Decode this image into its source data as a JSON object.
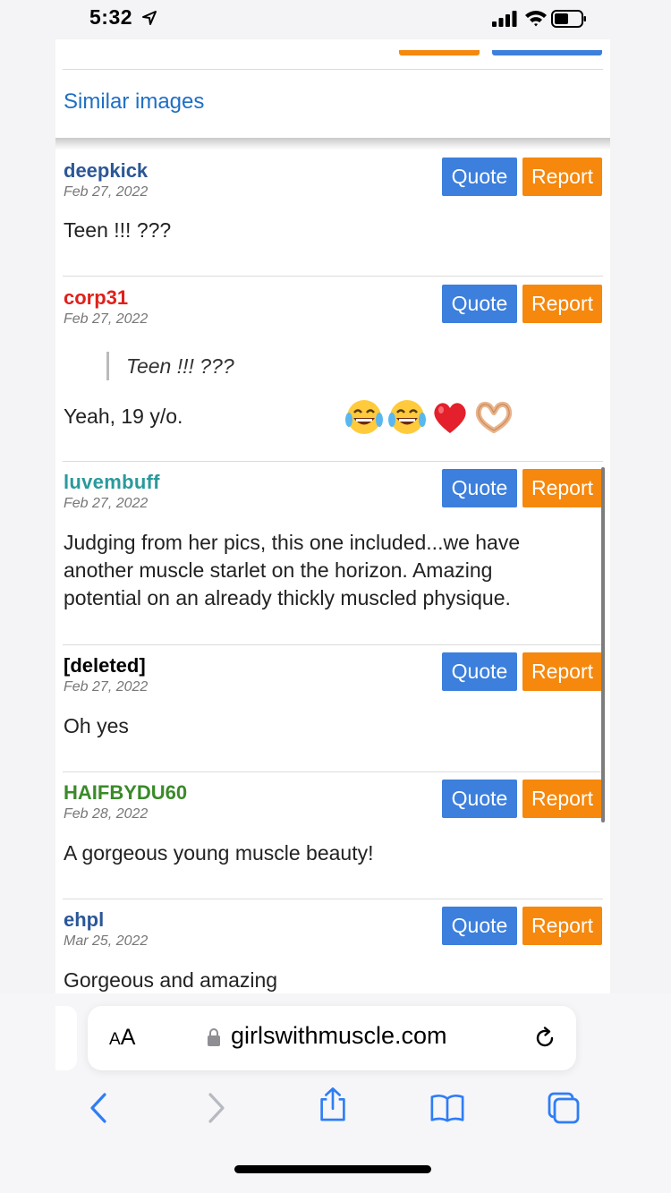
{
  "status_bar": {
    "time": "5:32"
  },
  "page": {
    "similar_link": "Similar images"
  },
  "comments": [
    {
      "user": "deepkick",
      "user_color": "#2b5797",
      "date": "Feb 27, 2022",
      "text": "Teen !!! ???"
    },
    {
      "user": "corp31",
      "user_color": "#e0201b",
      "date": "Feb 27, 2022",
      "quote": "Teen !!! ???",
      "text": "Yeah, 19 y/o."
    },
    {
      "user": "luvembuff",
      "user_color": "#2a9a9c",
      "date": "Feb 27, 2022",
      "text": "Judging from her pics, this one included...we have another muscle starlet on the horizon. Amazing potential on an already thickly muscled physique."
    },
    {
      "user": "[deleted]",
      "user_color": "#000000",
      "date": "Feb 27, 2022",
      "text": "Oh yes"
    },
    {
      "user": "HAIFBYDU60",
      "user_color": "#3a8a2a",
      "date": "Feb 28, 2022",
      "text": "A gorgeous young muscle beauty!"
    },
    {
      "user": "ehpl",
      "user_color": "#2b5797",
      "date": "Mar 25, 2022",
      "text": "Gorgeous and amazing"
    }
  ],
  "buttons": {
    "quote": "Quote",
    "report": "Report"
  },
  "emojis": [
    "laughing-tears-icon",
    "laughing-tears-icon",
    "red-heart-icon",
    "heart-hands-icon"
  ],
  "browser": {
    "aa_big": "A",
    "aa_small": "A",
    "url": "girlswithmuscle.com"
  },
  "colors": {
    "quote_button": "#3c7fdc",
    "report_button": "#f5880d",
    "link": "#1f6fc5",
    "safari_accent": "#2f7df6"
  }
}
